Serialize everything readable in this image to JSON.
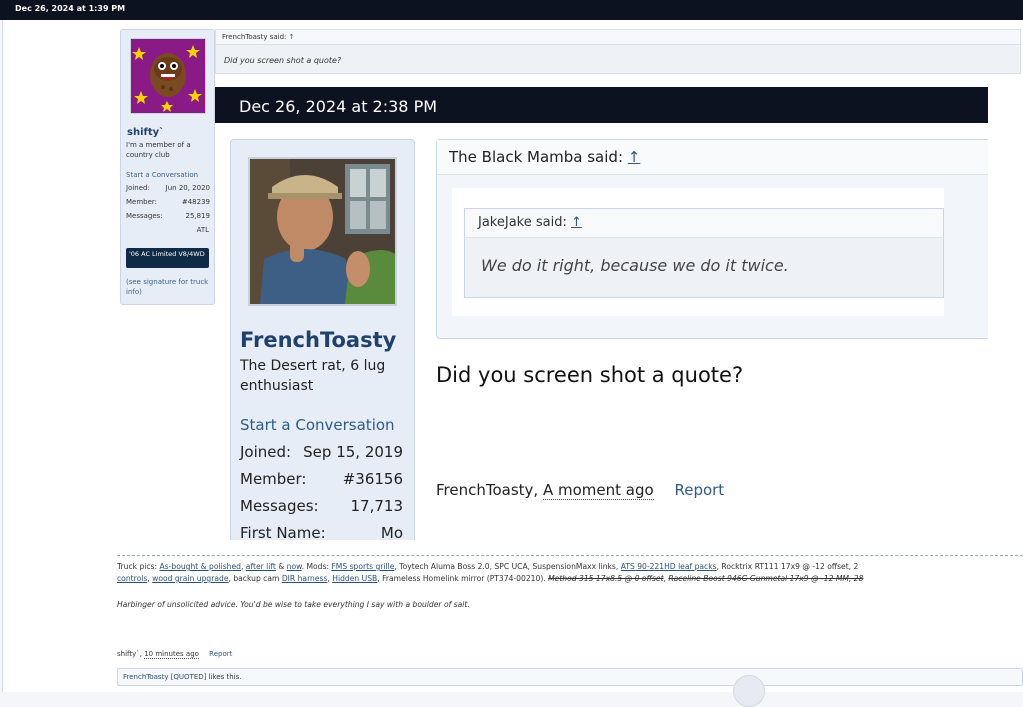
{
  "post": {
    "date": "Dec 26, 2024 at 1:39 PM",
    "user": {
      "name": "shifty`",
      "title": "I'm a member of a country club",
      "start_conversation": "Start a Conversation",
      "stats": [
        {
          "label": "Joined:",
          "value": "Jun 20, 2020"
        },
        {
          "label": "Member:",
          "value": "#48239"
        },
        {
          "label": "Messages:",
          "value": "25,819"
        }
      ],
      "location": "ATL",
      "truck_badge": "'06 AC Limited V8/4WD",
      "signature_note": "(see signature for truck info)"
    },
    "quote": {
      "author_said": "FrenchToasty said:",
      "arrow": "↑",
      "text": "Did you screen shot a quote?"
    },
    "screenshot": {
      "date": "Dec 26, 2024 at 2:38 PM",
      "user": {
        "name": "FrenchToasty",
        "title": "The Desert rat, 6 lug enthusiast",
        "start_conversation": "Start a Conversation",
        "stats": [
          {
            "label": "Joined:",
            "value": "Sep 15, 2019"
          },
          {
            "label": "Member:",
            "value": "#36156"
          },
          {
            "label": "Messages:",
            "value": "17,713"
          },
          {
            "label": "First Name:",
            "value": "Mo"
          }
        ]
      },
      "quote_outer_said": "The Black Mamba said:",
      "quote_inner_said": "JakeJake said:",
      "quote_inner_text": "We do it right, because we do it twice.",
      "arrow": "↑",
      "body": "Did you screen shot a quote?",
      "footer_author": "FrenchToasty,",
      "footer_time": "A moment ago",
      "footer_report": "Report"
    },
    "signature": {
      "line1": [
        {
          "t": "text",
          "v": "Truck pics: "
        },
        {
          "t": "link",
          "v": "As-bought & polished"
        },
        {
          "t": "text",
          "v": ", "
        },
        {
          "t": "link",
          "v": "after lift"
        },
        {
          "t": "text",
          "v": " & "
        },
        {
          "t": "link",
          "v": "now"
        },
        {
          "t": "text",
          "v": ". Mods: "
        },
        {
          "t": "link",
          "v": "FMS sports grille"
        },
        {
          "t": "text",
          "v": ", Toytech Aluma Boss 2.0, SPC UCA, SuspensionMaxx links, "
        },
        {
          "t": "link",
          "v": "ATS 90-221HD leaf packs"
        },
        {
          "t": "text",
          "v": ", Rocktrix RT111 17x9 @ -12 offset, 2"
        }
      ],
      "line2": [
        {
          "t": "link",
          "v": "controls"
        },
        {
          "t": "text",
          "v": ", "
        },
        {
          "t": "link",
          "v": "wood grain upgrade"
        },
        {
          "t": "text",
          "v": ", backup cam "
        },
        {
          "t": "link",
          "v": "DIR harness"
        },
        {
          "t": "text",
          "v": ", "
        },
        {
          "t": "link",
          "v": "Hidden USB"
        },
        {
          "t": "text",
          "v": ", Frameless Homelink mirror (PT374-00210). "
        },
        {
          "t": "strike",
          "v": "Method 315 17x8.5 @ 0 offset"
        },
        {
          "t": "text",
          "v": ", "
        },
        {
          "t": "strike",
          "v": "Raceline Boost 946G Gunmetal 17x9 @ -12 MM, 28"
        }
      ],
      "line3": "Harbinger of unsolicited advice. You'd be wise to take everything I say with a boulder of salt."
    },
    "footer": {
      "author": "shifty`,",
      "time": "10 minutes ago",
      "report": "Report"
    },
    "likes": {
      "user": "FrenchToasty [QUOTED]",
      "suffix": " likes this."
    }
  }
}
